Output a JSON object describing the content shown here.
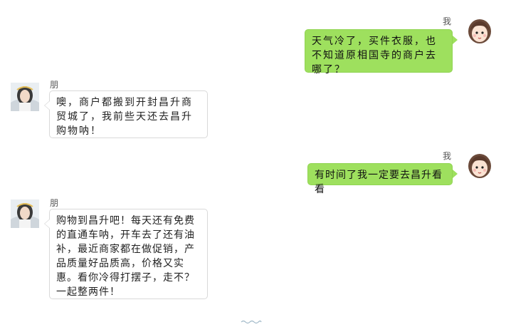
{
  "chat": {
    "messages": [
      {
        "sender": "我",
        "side": "right",
        "text": "天气冷了，买件衣服，也不知道原相国寺的商户去哪了？"
      },
      {
        "sender": "朋友",
        "side": "left",
        "text": "噢，商户都搬到开封昌升商贸城了，我前些天还去昌升购物呐！"
      },
      {
        "sender": "我",
        "side": "right",
        "text": "有时间了我一定要去昌升看看"
      },
      {
        "sender": "朋友",
        "side": "left",
        "text": "购物到昌升吧！每天还有免费的直通车呐，开车去了还有油补，最近商家都在做促销，产品质量好品质高，价格又实惠。看你冷得打摆子，走不？一起整两件！"
      }
    ]
  },
  "colors": {
    "my_bubble": "#9ee05e",
    "friend_bubble": "#ffffff",
    "friend_border": "#d9d9d9"
  },
  "icons": {
    "my_avatar": "cartoon-girl-avatar-icon",
    "friend_avatar": "photo-girl-avatar-icon"
  }
}
